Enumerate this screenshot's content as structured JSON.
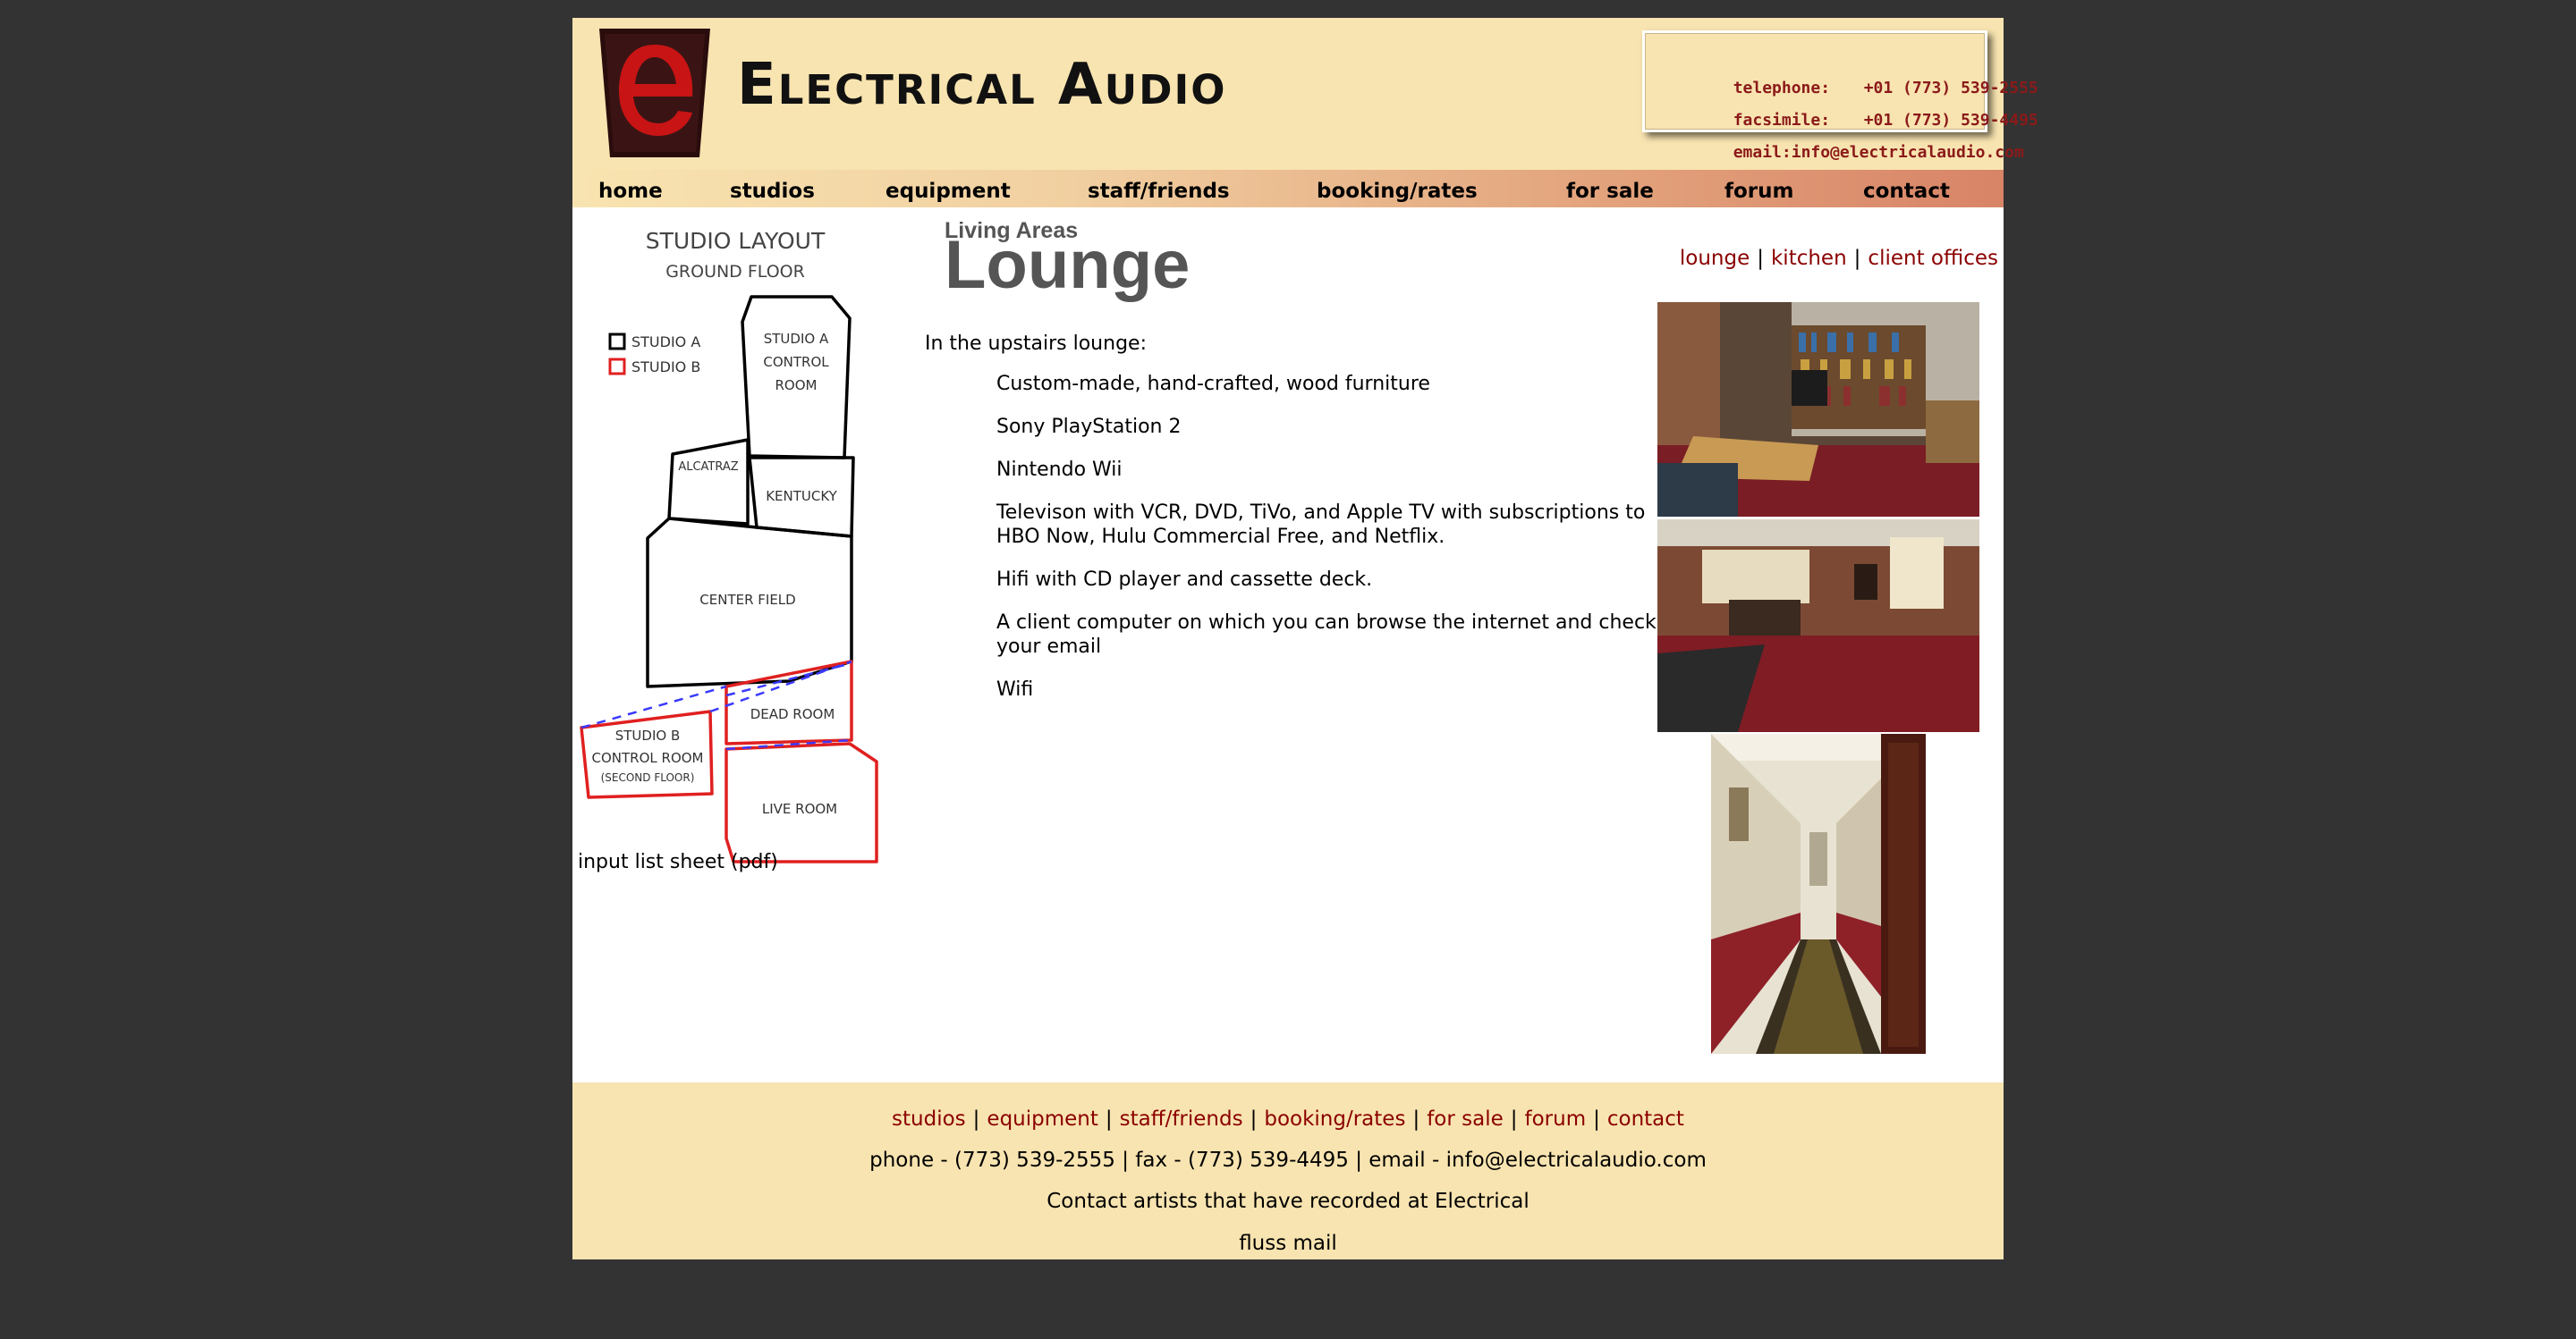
{
  "header": {
    "site_name": "Electrical Audio",
    "contact_card": [
      {
        "label": "telephone:",
        "value": "+01 (773) 539-2555"
      },
      {
        "label": "facsimile:",
        "value": "+01 (773) 539-4495"
      },
      {
        "label": "email:",
        "value": "info@electricalaudio.com"
      }
    ],
    "colors": {
      "brand_red": "#8b1a1a",
      "header_bg": "#f8e4b0",
      "logo_dark": "#2a0c0c"
    }
  },
  "nav": {
    "items": [
      {
        "label": "home"
      },
      {
        "label": "studios"
      },
      {
        "label": "equipment"
      },
      {
        "label": "staff/friends"
      },
      {
        "label": "booking/rates"
      },
      {
        "label": "for sale"
      },
      {
        "label": "forum"
      },
      {
        "label": "contact"
      }
    ]
  },
  "layout_map": {
    "title": "STUDIO LAYOUT",
    "subtitle": "GROUND FLOOR",
    "legend": [
      {
        "label": "STUDIO A",
        "color": "#000000"
      },
      {
        "label": "STUDIO B",
        "color": "#e02020"
      }
    ],
    "rooms": {
      "studio_a_control_line1": "STUDIO A",
      "studio_a_control_line2": "CONTROL",
      "studio_a_control_line3": "ROOM",
      "alcatraz": "ALCATRAZ",
      "kentucky": "KENTUCKY",
      "center_field": "CENTER FIELD",
      "dead_room": "DEAD ROOM",
      "studio_b_control_line1": "STUDIO B",
      "studio_b_control_line2": "CONTROL ROOM",
      "studio_b_control_line3": "(SECOND FLOOR)",
      "live_room": "LIVE ROOM"
    },
    "input_list_link": "input list sheet (pdf)"
  },
  "main": {
    "heading_small": "Living Areas",
    "heading_big": "Lounge",
    "intro": "In the upstairs lounge:",
    "features": [
      "Custom-made, hand-crafted, wood furniture",
      "Sony PlayStation 2",
      "Nintendo Wii",
      "Televison with VCR, DVD, TiVo, and Apple TV with subscriptions to HBO Now, Hulu Commercial Free, and Netflix.",
      "Hifi with CD player and cassette deck.",
      "A client computer on which you can browse the internet and check your email",
      "Wifi"
    ]
  },
  "sublinks": {
    "items": [
      "lounge",
      "kitchen",
      "client offices"
    ],
    "separator": "|"
  },
  "footer": {
    "links": [
      "studios",
      "equipment",
      "staff/friends",
      "booking/rates",
      "for sale",
      "forum",
      "contact"
    ],
    "separator": "|",
    "contact_line": "phone - (773) 539-2555 | fax - (773) 539-4495 | email - info@electricalaudio.com",
    "artists_line": "Contact artists that have recorded at Electrical",
    "fluss_mail": "fluss mail"
  }
}
